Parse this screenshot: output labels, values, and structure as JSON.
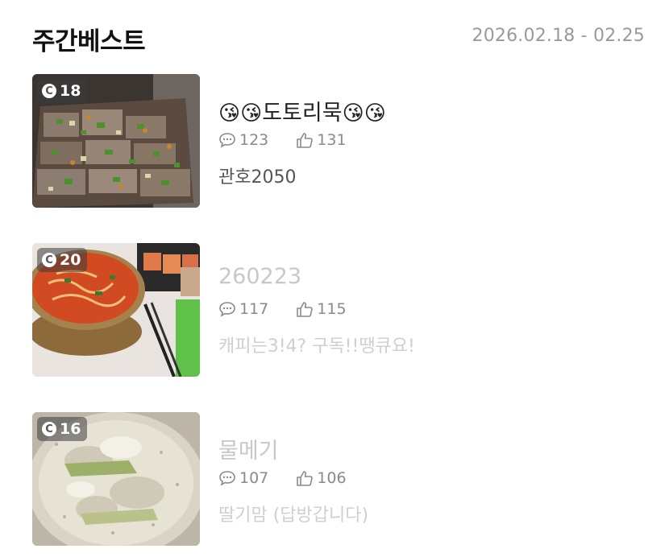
{
  "header": {
    "title": "주간베스트",
    "date_range": "2026.02.18 - 02.25"
  },
  "posts": [
    {
      "rank_badge": "18",
      "title_text": "도토리묵",
      "title_prefix_emoji": "😘😘",
      "title_suffix_emoji": "😘😘",
      "comments": "123",
      "likes": "131",
      "author": "관호2050",
      "thumbnail": "acorn-jelly-photo"
    },
    {
      "rank_badge": "20",
      "title_text": "260223",
      "comments": "117",
      "likes": "115",
      "author": "캐피는3!4? 구독!!땡큐요!",
      "thumbnail": "ramen-pot-photo"
    },
    {
      "rank_badge": "16",
      "title_text": "물메기",
      "comments": "107",
      "likes": "106",
      "author": "딸기맘 (답방갑니다)",
      "thumbnail": "fish-soup-photo"
    }
  ],
  "icons": {
    "badge": "c-coin-icon",
    "comments": "speech-bubble-icon",
    "likes": "thumbs-up-icon"
  }
}
